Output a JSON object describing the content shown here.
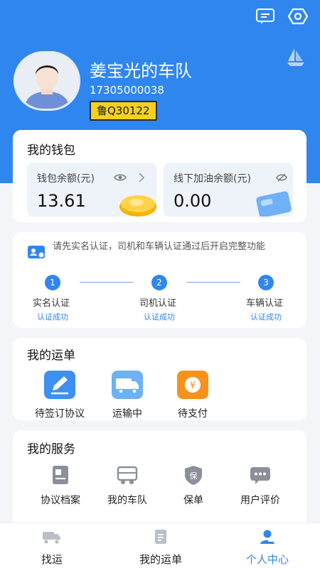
{
  "profile": {
    "name": "姜宝光的车队",
    "phone": "17305000038",
    "plate": "鲁Q30122"
  },
  "wallet": {
    "title": "我的钱包",
    "balance_label": "钱包余额(元)",
    "balance_value": "13.61",
    "fuel_label": "线下加油余额(元)",
    "fuel_value": "0.00"
  },
  "verification": {
    "notice": "请先实名认证，司机和车辆认证通过后开启完整功能",
    "steps": [
      {
        "num": "1",
        "name": "实名认证",
        "status": "认证成功"
      },
      {
        "num": "2",
        "name": "司机认证",
        "status": "认证成功"
      },
      {
        "num": "3",
        "name": "车辆认证",
        "status": "认证成功"
      }
    ]
  },
  "orders": {
    "title": "我的运单",
    "items": [
      {
        "label": "待签订协议",
        "icon": "sign-agreement-icon"
      },
      {
        "label": "运输中",
        "icon": "truck-icon"
      },
      {
        "label": "待支付",
        "icon": "yen-pay-icon"
      }
    ]
  },
  "services": {
    "title": "我的服务",
    "items": [
      {
        "label": "协议档案",
        "icon": "archive-icon"
      },
      {
        "label": "我的车队",
        "icon": "fleet-icon"
      },
      {
        "label": "保单",
        "icon": "insurance-icon"
      },
      {
        "label": "用户评价",
        "icon": "review-icon"
      }
    ]
  },
  "tabbar": {
    "items": [
      {
        "label": "找运",
        "icon": "truck-icon"
      },
      {
        "label": "我的运单",
        "icon": "document-icon"
      },
      {
        "label": "个人中心",
        "icon": "user-icon"
      }
    ],
    "active": "个人中心"
  },
  "colors": {
    "primary": "#2f86ee",
    "plate_yellow": "#f6d01e",
    "order_blue": "#3d8ff0",
    "order_orange": "#f7921d"
  }
}
